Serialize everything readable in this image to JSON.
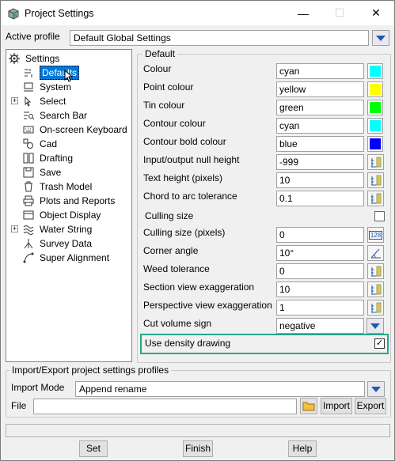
{
  "window": {
    "title": "Project Settings",
    "minimize": "—",
    "maximize": "☐",
    "close": "✕"
  },
  "active_profile": {
    "label": "Active profile",
    "value": "Default Global Settings"
  },
  "tree": {
    "root": "Settings",
    "items": [
      {
        "label": "Defaults",
        "selected": true,
        "icon": "defaults-icon"
      },
      {
        "label": "System",
        "icon": "computer-icon"
      },
      {
        "label": "Select",
        "icon": "select-icon",
        "expandable": true
      },
      {
        "label": "Search Bar",
        "icon": "search-bar-icon"
      },
      {
        "label": "On-screen Keyboard",
        "icon": "keyboard-icon"
      },
      {
        "label": "Cad",
        "icon": "cad-icon"
      },
      {
        "label": "Drafting",
        "icon": "drafting-icon"
      },
      {
        "label": "Save",
        "icon": "save-icon"
      },
      {
        "label": "Trash Model",
        "icon": "trash-icon"
      },
      {
        "label": "Plots and Reports",
        "icon": "printer-icon"
      },
      {
        "label": "Object Display",
        "icon": "object-display-icon"
      },
      {
        "label": "Water String",
        "icon": "water-string-icon",
        "expandable": true
      },
      {
        "label": "Survey Data",
        "icon": "survey-icon"
      },
      {
        "label": "Super Alignment",
        "icon": "alignment-icon"
      }
    ]
  },
  "defaults": {
    "group_title": "Default",
    "colour": {
      "label": "Colour",
      "value": "cyan",
      "swatch": "#00ffff"
    },
    "point_colour": {
      "label": "Point colour",
      "value": "yellow",
      "swatch": "#ffff00"
    },
    "tin_colour": {
      "label": "Tin colour",
      "value": "green",
      "swatch": "#00ff00"
    },
    "contour_colour": {
      "label": "Contour colour",
      "value": "cyan",
      "swatch": "#00ffff"
    },
    "contour_bold_colour": {
      "label": "Contour bold colour",
      "value": "blue",
      "swatch": "#0000ff"
    },
    "null_height": {
      "label": "Input/output null height",
      "value": "-999"
    },
    "text_height": {
      "label": "Text height (pixels)",
      "value": "10"
    },
    "chord_tolerance": {
      "label": "Chord to arc tolerance",
      "value": "0.1"
    },
    "culling_size": {
      "label": "Culling size",
      "checked": false
    },
    "culling_size_pixels": {
      "label": "Culling size (pixels)",
      "value": "0",
      "button": "128"
    },
    "corner_angle": {
      "label": "Corner angle",
      "value": "10°"
    },
    "weed_tolerance": {
      "label": "Weed tolerance",
      "value": "0"
    },
    "section_exag": {
      "label": "Section view exaggeration",
      "value": "10"
    },
    "perspective_exag": {
      "label": "Perspective view exaggeration",
      "value": "1"
    },
    "cut_volume_sign": {
      "label": "Cut volume sign",
      "value": "negative"
    },
    "density_drawing": {
      "label": "Use density drawing",
      "checked": true,
      "highlight": "#27a589"
    }
  },
  "import_export": {
    "group_title": "Import/Export project settings profiles",
    "mode_label": "Import Mode",
    "mode_value": "Append rename",
    "file_label": "File",
    "file_value": "",
    "import_button": "Import",
    "export_button": "Export"
  },
  "footer": {
    "set": "Set",
    "finish": "Finish",
    "help": "Help"
  }
}
